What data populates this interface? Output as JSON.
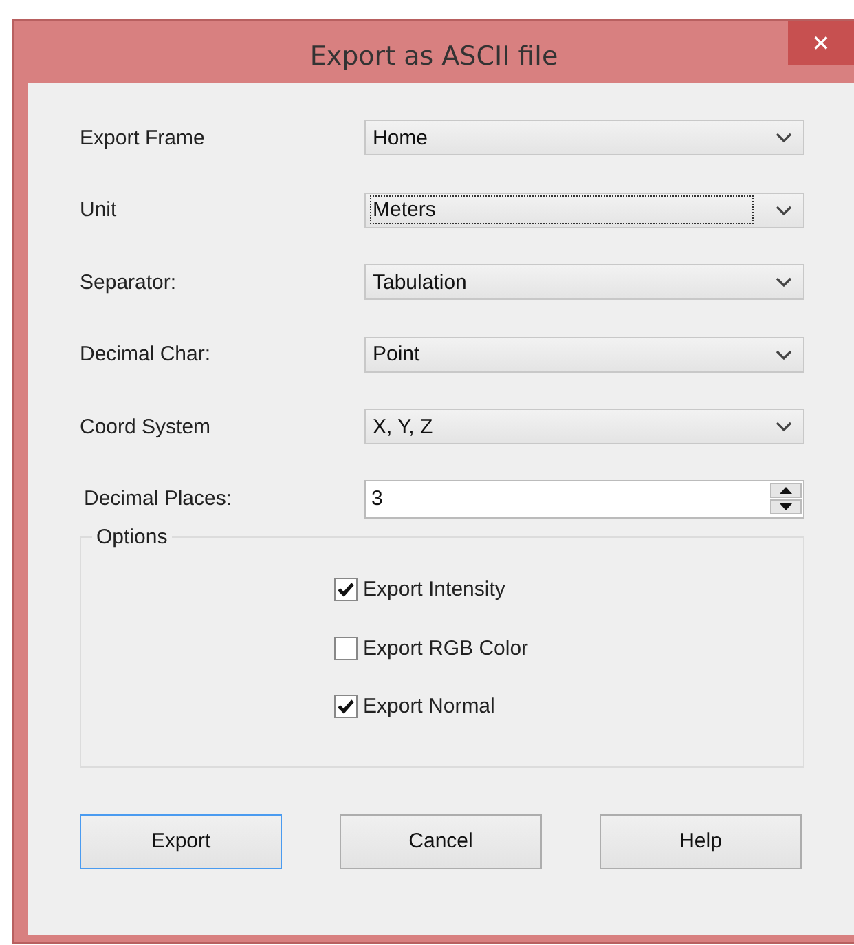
{
  "window": {
    "title": "Export as ASCII file",
    "close": "✕"
  },
  "fields": [
    {
      "kind": "select",
      "label": "Export Frame",
      "value": "Home",
      "focused": false
    },
    {
      "kind": "select",
      "label": "Unit",
      "value": "Meters",
      "focused": true
    },
    {
      "kind": "select",
      "label": "Separator:",
      "value": "Tabulation",
      "focused": false
    },
    {
      "kind": "select",
      "label": "Decimal Char:",
      "value": "Point",
      "focused": false
    },
    {
      "kind": "select",
      "label": "Coord System",
      "value": "X, Y, Z",
      "focused": false
    },
    {
      "kind": "spin",
      "label": "Decimal Places:",
      "value": "3",
      "focused": false
    }
  ],
  "options": {
    "title": "Options",
    "items": [
      {
        "label": "Export Intensity",
        "checked": true
      },
      {
        "label": "Export RGB Color",
        "checked": false
      },
      {
        "label": "Export Normal",
        "checked": true
      }
    ]
  },
  "buttons": [
    {
      "label": "Export",
      "default": true
    },
    {
      "label": "Cancel",
      "default": false
    },
    {
      "label": "Help",
      "default": false
    }
  ]
}
